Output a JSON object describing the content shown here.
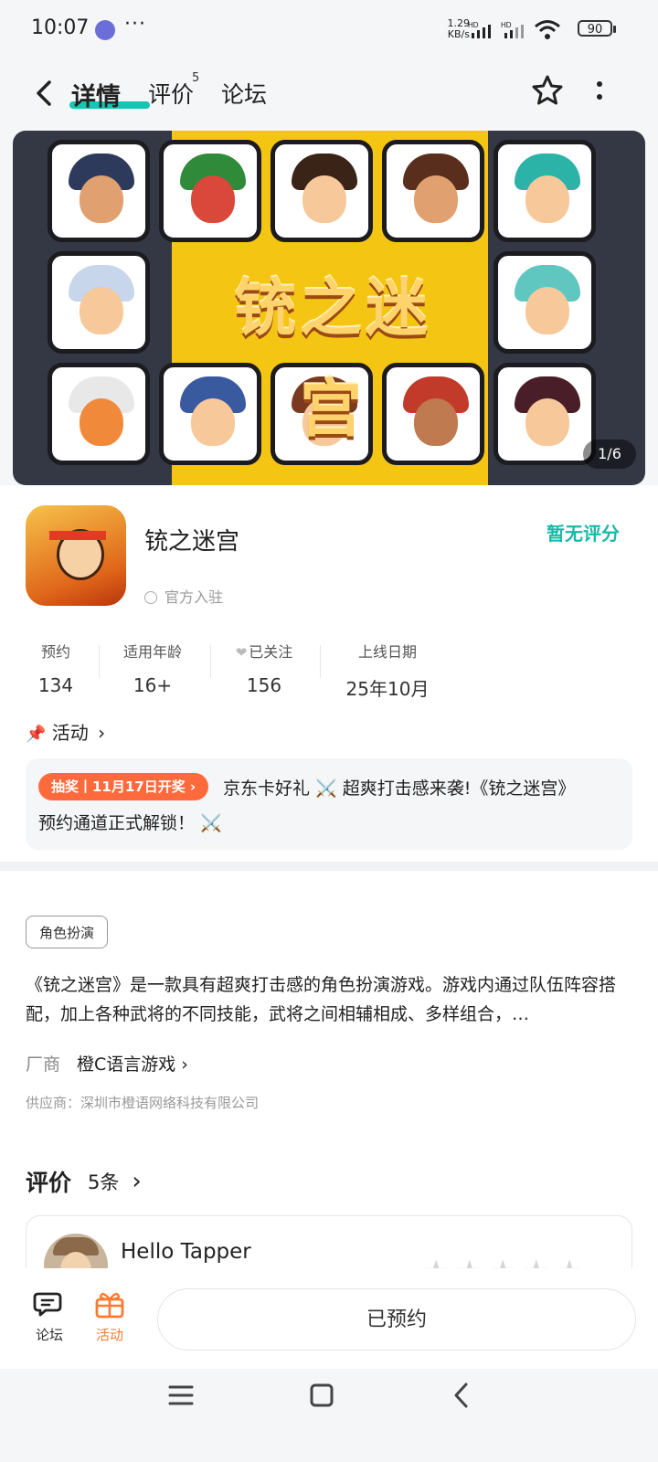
{
  "status_bar": {
    "time": "10:07",
    "more": "···",
    "netspeed_value": "1.29",
    "netspeed_unit": "KB/s",
    "battery": "90"
  },
  "nav": {
    "tabs": [
      {
        "label": "详情",
        "active": true
      },
      {
        "label": "评价",
        "badge": "5"
      },
      {
        "label": "论坛"
      }
    ]
  },
  "banner": {
    "art_title": "铳之迷宫",
    "pager": "1/6"
  },
  "app": {
    "name": "铳之迷宫",
    "official": "官方入驻",
    "rating": "暂无评分"
  },
  "stats": [
    {
      "label": "预约",
      "value": "134"
    },
    {
      "label": "适用年龄",
      "value": "16+"
    },
    {
      "label": "已关注",
      "value": "156"
    },
    {
      "label": "上线日期",
      "value": "25年10月"
    }
  ],
  "activity": {
    "heading": "活动",
    "tag": "抽奖丨11月17日开奖 ›",
    "line1": "京东卡好礼 ⚔️ 超爽打击感来袭!《铳之迷宫》",
    "line2": "预约通道正式解锁！ ⚔️"
  },
  "genre_tag": "角色扮演",
  "description": "《铳之迷宫》是一款具有超爽打击感的角色扮演游戏。游戏内通过队伍阵容搭配，加上各种武将的不同技能，武将之间相辅相成、多样组合，…",
  "maker": {
    "label": "厂商",
    "name": "橙C语言游戏"
  },
  "supplier": "供应商：深圳市橙语网络科技有限公司",
  "reviews": {
    "heading": "评价",
    "count": "5条",
    "first_reviewer": "Hello Tapper",
    "stars": "★★★★★"
  },
  "bottom_bar": {
    "forum": "论坛",
    "activity": "活动",
    "reserved": "已预约"
  },
  "colors": {
    "accent": "#18c4b4",
    "promo": "#ff6a3d",
    "activity_orange": "#ff7a2e"
  }
}
